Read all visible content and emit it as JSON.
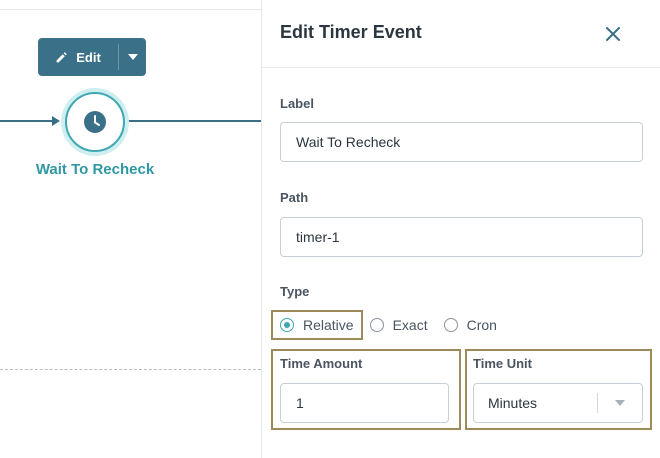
{
  "canvas": {
    "edit_button_label": "Edit",
    "node_label": "Wait To Recheck",
    "icons": {
      "edit": "pencil-icon",
      "dropdown": "caret-down-icon",
      "node": "clock-icon"
    }
  },
  "panel": {
    "title": "Edit Timer Event",
    "close_icon": "close-icon",
    "label_field": {
      "label": "Label",
      "value": "Wait To Recheck"
    },
    "path_field": {
      "label": "Path",
      "value": "timer-1"
    },
    "type_field": {
      "label": "Type",
      "options": [
        "Relative",
        "Exact",
        "Cron"
      ],
      "selected": "Relative"
    },
    "time_amount": {
      "label": "Time Amount",
      "value": "1"
    },
    "time_unit": {
      "label": "Time Unit",
      "value": "Minutes"
    }
  },
  "colors": {
    "accent_teal": "#3fa8b2",
    "button_blue": "#3b7089",
    "highlight_gold": "#9c8a5a"
  }
}
